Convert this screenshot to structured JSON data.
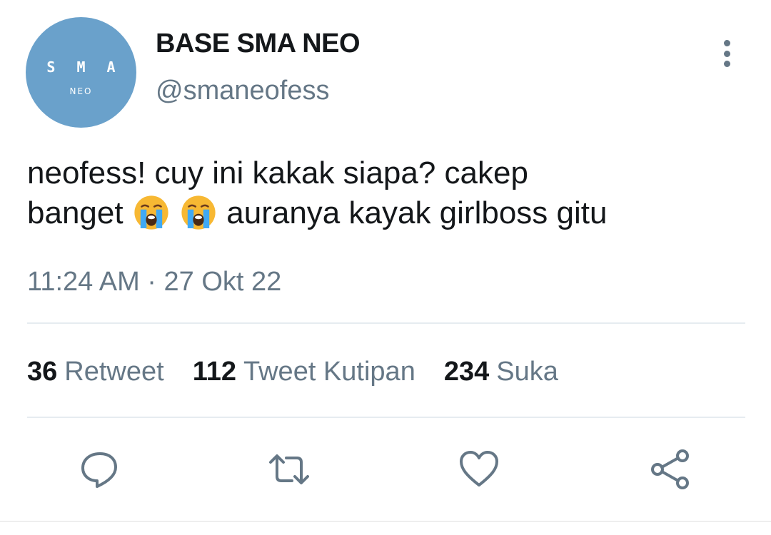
{
  "account": {
    "display_name": "BASE SMA NEO",
    "handle": "@smaneofess",
    "avatar": {
      "letters": [
        "S",
        "M",
        "A"
      ],
      "sub": "NEO",
      "color": "#6aa1cb"
    }
  },
  "tweet": {
    "line1": "neofess! cuy ini kakak siapa? cakep",
    "line2_before": "banget ",
    "line2_after": " auranya kayak girlboss gitu",
    "emoji": "loudly-crying-face",
    "timestamp": "11:24 AM · 27 Okt 22"
  },
  "stats": {
    "retweets": {
      "count": "36",
      "label": "Retweet"
    },
    "quotes": {
      "count": "112",
      "label": "Tweet Kutipan"
    },
    "likes": {
      "count": "234",
      "label": "Suka"
    }
  },
  "icons": {
    "more": "more-vertical-icon",
    "reply": "reply-icon",
    "retweet": "retweet-icon",
    "like": "heart-icon",
    "share": "share-icon"
  },
  "colors": {
    "primary_text": "#14171a",
    "secondary_text": "#657786",
    "divider": "#e6ecf0",
    "avatar_bg": "#6aa1cb"
  }
}
